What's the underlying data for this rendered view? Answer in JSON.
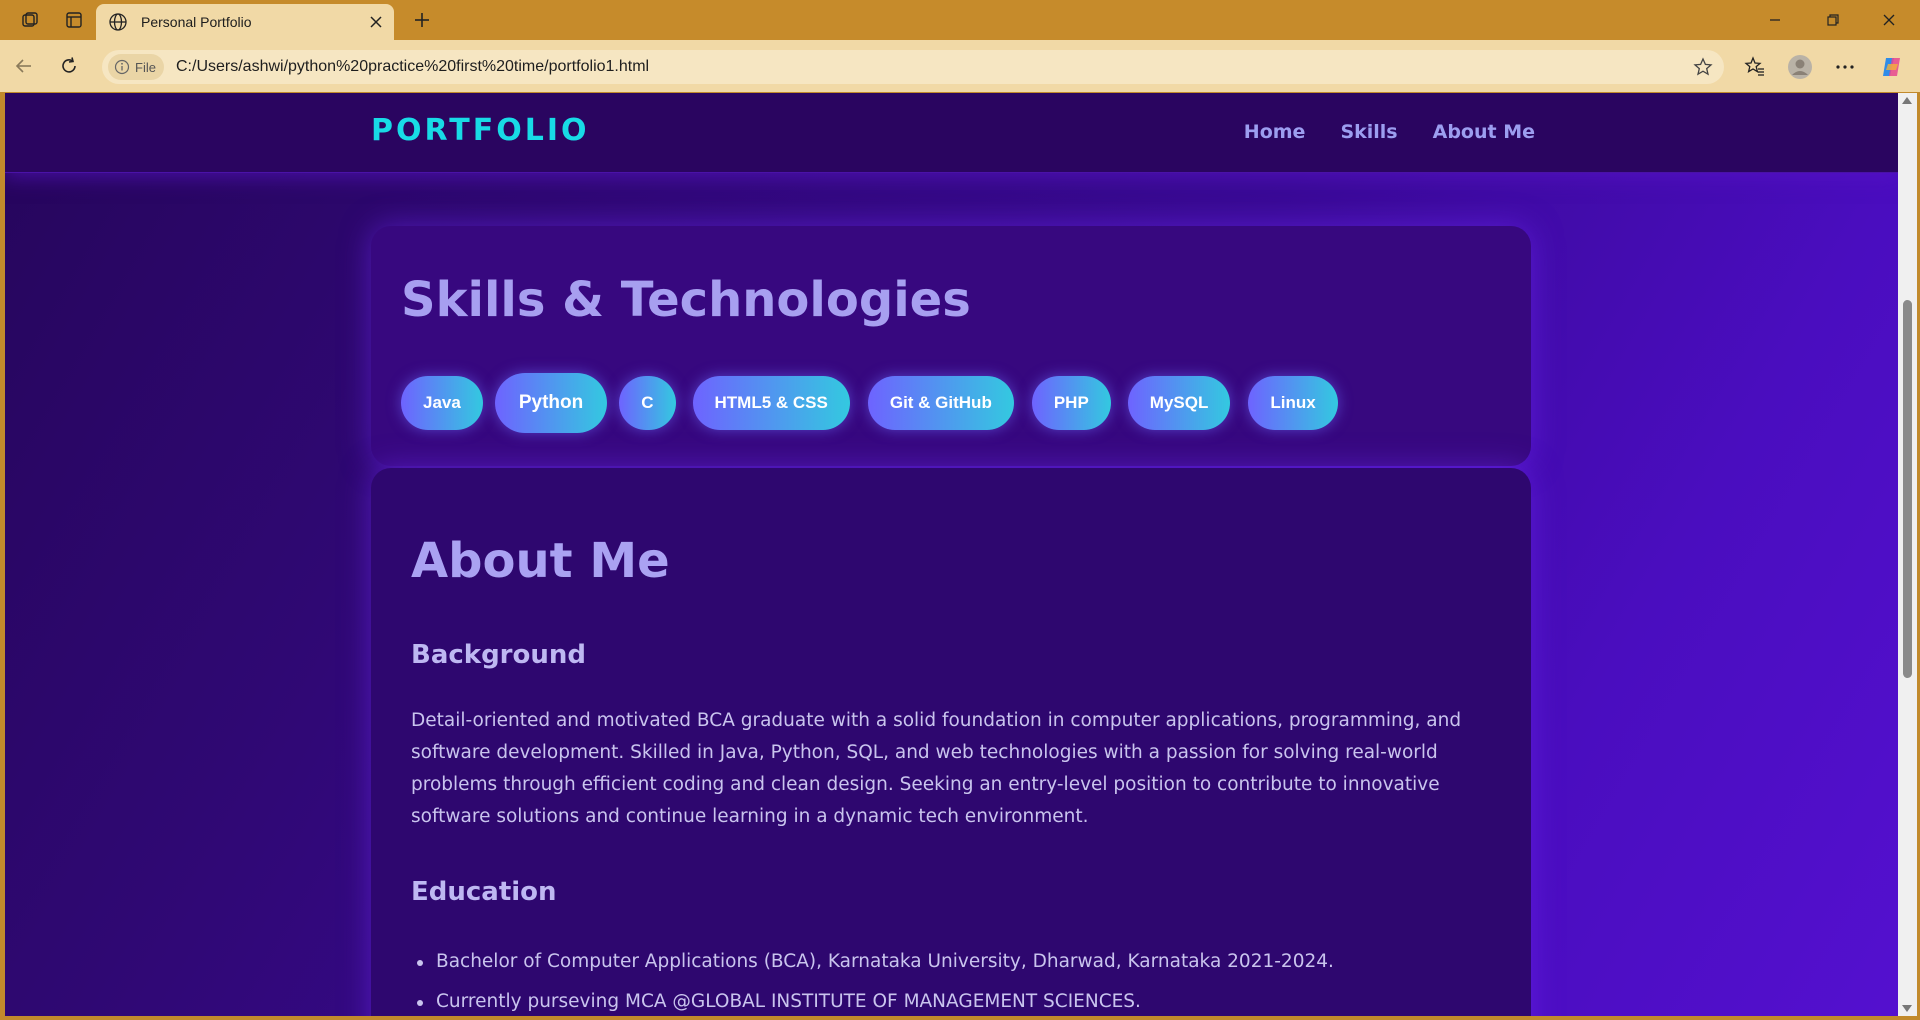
{
  "browser": {
    "tab_title": "Personal Portfolio",
    "address_badge": "File",
    "url": "C:/Users/ashwi/python%20practice%20first%20time/portfolio1.html"
  },
  "site": {
    "logo": "PORTFOLIO",
    "nav": [
      "Home",
      "Skills",
      "About Me"
    ]
  },
  "skills": {
    "title": "Skills & Technologies",
    "items": [
      "Java",
      "Python",
      "C",
      "HTML5 & CSS",
      "Git & GitHub",
      "PHP",
      "MySQL",
      "Linux"
    ],
    "gradient_start": "#6e63ff",
    "gradient_end": "#33c9e0"
  },
  "about": {
    "title": "About Me",
    "background_heading": "Background",
    "background_text": "Detail-oriented and motivated BCA graduate with a solid foundation in computer applications, programming, and software development. Skilled in Java, Python, SQL, and web technologies with a passion for solving real-world problems through efficient coding and clean design. Seeking an entry-level position to contribute to innovative software solutions and continue learning in a dynamic tech environment.",
    "education_heading": "Education",
    "education": [
      "Bachelor of Computer Applications (BCA), Karnataka University, Dharwad, Karnataka 2021-2024.",
      "Currently purseving MCA @GLOBAL INSTITUTE OF MANAGEMENT SCIENCES."
    ]
  },
  "colors": {
    "accent_logo": "#18dbe6",
    "nav_text": "#9c9ef0",
    "browser_frame": "#c68b2b"
  }
}
